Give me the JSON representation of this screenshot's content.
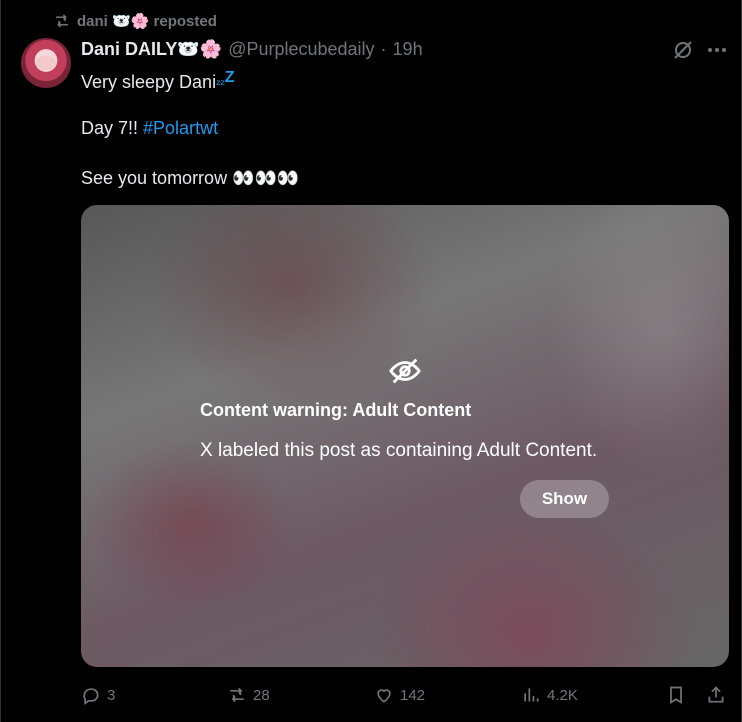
{
  "repost": {
    "label": "dani 🐻‍❄️🌸 reposted"
  },
  "author": {
    "name": "Dani DAILY🐻‍❄️🌸",
    "handle": "@Purplecubedaily",
    "separator": "·",
    "time": "19h"
  },
  "post": {
    "line1": "Very sleepy Dani",
    "zzz_small": "ᶻᶻ",
    "zzz_big": "Z",
    "line2_prefix": "Day 7!! ",
    "hashtag": "#Polartwt",
    "line3": "See you tomorrow 👀👀👀"
  },
  "media_warning": {
    "title": "Content warning: Adult Content",
    "description": "X labeled this post as containing Adult Content.",
    "show_label": "Show"
  },
  "actions": {
    "replies": "3",
    "reposts": "28",
    "likes": "142",
    "views": "4.2K"
  },
  "colors": {
    "background": "#000000",
    "text": "#e7e9ea",
    "muted": "#71767b",
    "link": "#1d9bf0"
  },
  "icons": [
    "repost-icon",
    "grok-icon",
    "more-icon",
    "hide-icon",
    "reply-icon",
    "like-icon",
    "views-icon",
    "bookmark-icon",
    "share-icon"
  ]
}
